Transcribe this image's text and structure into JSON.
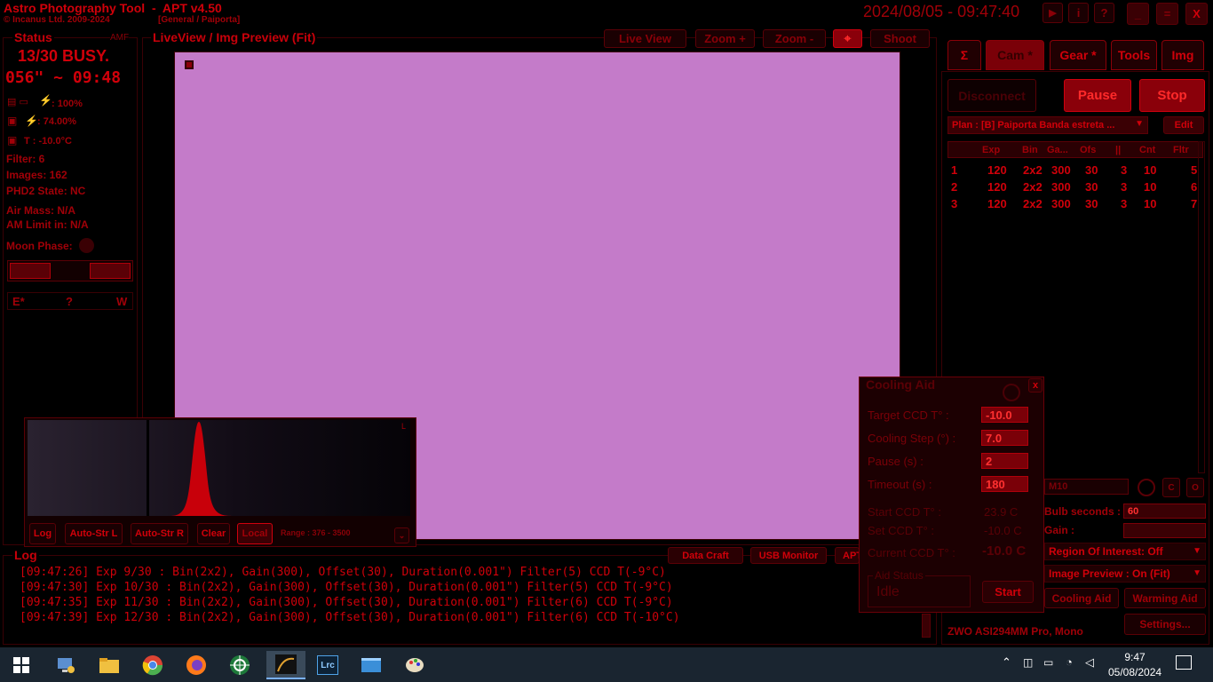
{
  "titlebar": {
    "app_title": "Astro Photography Tool  -  APT v4.50",
    "copyright": "© Incanus Ltd. 2009-2024",
    "profile": "[General / Paiporta]",
    "datetime": "2024/08/05 - 09:47:40",
    "btn_play": "▶",
    "btn_info": "i",
    "btn_help": "?",
    "btn_min": "_",
    "btn_max": "=",
    "btn_close": "X"
  },
  "status": {
    "title": "Status",
    "amf": "AMF",
    "busy": "13/30 BUSY.",
    "elapsed": "056\" ~ 09:48",
    "battery1": ": 100%",
    "battery2": ": 74.00%",
    "temp": "T : -10.0°C",
    "filter": "Filter: 6",
    "images": "Images: 162",
    "phd2": "PHD2 State: NC",
    "airmass": "Air Mass: N/A",
    "amlimit": "AM Limit in: N/A",
    "moon": "Moon Phase:",
    "e": "E*",
    "q": "?",
    "w": "W"
  },
  "preview": {
    "title": "LiveView / Img Preview (Fit)",
    "live_view": "Live View",
    "zoom_in": "Zoom +",
    "zoom_out": "Zoom -",
    "shoot": "Shoot",
    "image_color": "#c47bc9"
  },
  "histogram": {
    "corner": "L",
    "log": "Log",
    "autostr_l": "Auto-Str L",
    "autostr_r": "Auto-Str R",
    "clear": "Clear",
    "local": "Local",
    "range": "Range : 376 - 3500"
  },
  "tabs": [
    {
      "label": "Σ"
    },
    {
      "label": "Cam *"
    },
    {
      "label": "Gear *"
    },
    {
      "label": "Tools"
    },
    {
      "label": "Img"
    }
  ],
  "cam": {
    "disconnect": "Disconnect",
    "pause": "Pause",
    "stop": "Stop",
    "plan": "Plan : [B] Paiporta Banda estreta ...",
    "edit": "Edit",
    "headers": [
      "",
      "Exp",
      "Bin",
      "Ga...",
      "Ofs",
      "||",
      "Cnt",
      "Fltr"
    ],
    "rows": [
      [
        "1",
        "120",
        "2x2",
        "300",
        "30",
        "3",
        "10",
        "5"
      ],
      [
        "2",
        "120",
        "2x2",
        "300",
        "30",
        "3",
        "10",
        "6"
      ],
      [
        "3",
        "120",
        "2x2",
        "300",
        "30",
        "3",
        "10",
        "7"
      ]
    ],
    "m10": "M10",
    "c_btn": "C",
    "o_btn": "O",
    "bulb_label": "Bulb seconds :",
    "bulb_value": "60",
    "gain_label": "Gain :",
    "roi": "Region Of Interest: Off",
    "img_preview": "Image Preview : On (Fit)",
    "cooling_aid": "Cooling Aid",
    "warming_aid": "Warming Aid",
    "camera": "ZWO ASI294MM Pro, Mono",
    "settings": "Settings..."
  },
  "cooling": {
    "title": "Cooling Aid",
    "close": "x",
    "target_label": "Target CCD T° :",
    "target": "-10.0",
    "step_label": "Cooling Step (°) :",
    "step": "7.0",
    "pause_label": "Pause (s) :",
    "pause": "2",
    "timeout_label": "Timeout (s) :",
    "timeout": "180",
    "start_label": "Start CCD T° :",
    "start_val": "23.9 C",
    "set_label": "Set CCD T° :",
    "set_val": "-10.0 C",
    "current_label": "Current CCD T° :",
    "current_val": "-10.0 C",
    "aid_status_label": "Aid Status",
    "aid_status": "Idle",
    "start_btn": "Start"
  },
  "log": {
    "title": "Log",
    "data_craft": "Data Craft",
    "usb_monitor": "USB Monitor",
    "apt": "APT",
    "lines": [
      "[09:47:26] Exp 9/30 : Bin(2x2), Gain(300), Offset(30), Duration(0.001\") Filter(5) CCD T(-9°C)",
      "[09:47:30] Exp 10/30 : Bin(2x2), Gain(300), Offset(30), Duration(0.001\") Filter(5) CCD T(-9°C)",
      "[09:47:35] Exp 11/30 : Bin(2x2), Gain(300), Offset(30), Duration(0.001\") Filter(6) CCD T(-9°C)",
      "[09:47:39] Exp 12/30 : Bin(2x2), Gain(300), Offset(30), Duration(0.001\") Filter(6) CCD T(-10°C)"
    ]
  },
  "taskbar": {
    "time": "9:47",
    "date": "05/08/2024",
    "lrc": "Lrc"
  }
}
